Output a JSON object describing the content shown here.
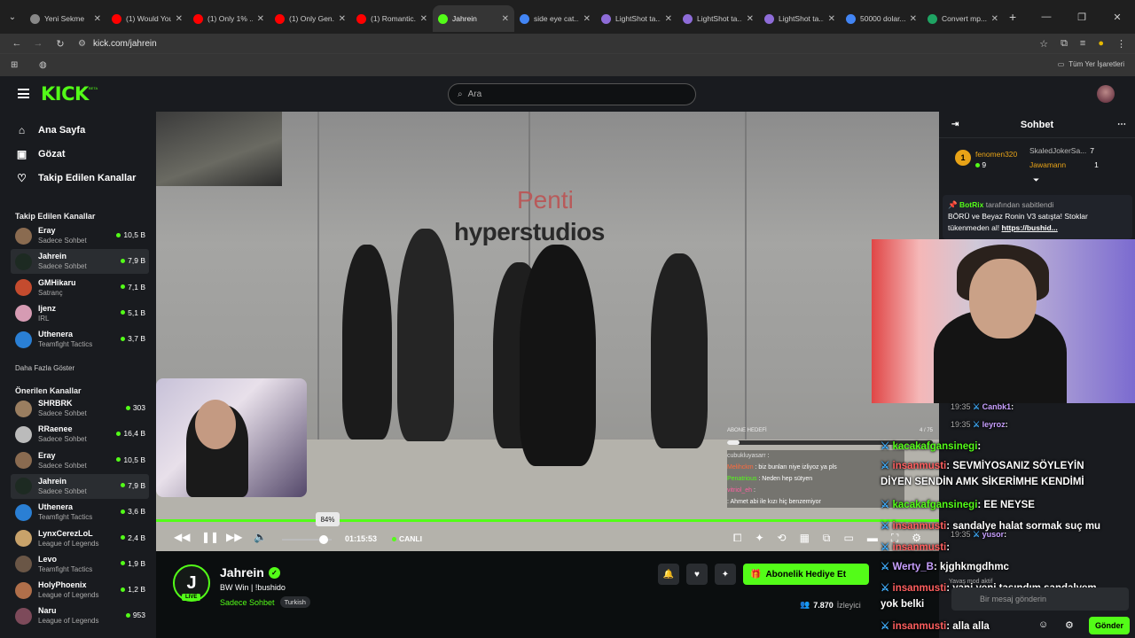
{
  "browser": {
    "tabs": [
      {
        "title": "Yeni Sekme",
        "color": "#888888"
      },
      {
        "title": "(1) Would You...",
        "color": "#ff0000"
      },
      {
        "title": "(1) Only 1% ...",
        "color": "#ff0000"
      },
      {
        "title": "(1) Only Gen...",
        "color": "#ff0000"
      },
      {
        "title": "(1) Romantic...",
        "color": "#ff0000"
      },
      {
        "title": "Jahrein",
        "color": "#53fc18"
      },
      {
        "title": "side eye cat...",
        "color": "#4285f4"
      },
      {
        "title": "LightShot ta...",
        "color": "#8e6cd8"
      },
      {
        "title": "LightShot ta...",
        "color": "#8e6cd8"
      },
      {
        "title": "LightShot ta...",
        "color": "#8e6cd8"
      },
      {
        "title": "50000 dolar...",
        "color": "#4285f4"
      },
      {
        "title": "Convert mp...",
        "color": "#1fa463"
      }
    ],
    "url": "kick.com/jahrein",
    "bookmarks_right": "Tüm Yer İşaretleri"
  },
  "header": {
    "logo": "KICK",
    "beta": "BETA",
    "search_placeholder": "Ara"
  },
  "sidebar": {
    "nav": [
      {
        "label": "Ana Sayfa",
        "icon": "home-icon",
        "glyph": "⌂"
      },
      {
        "label": "Gözat",
        "icon": "browse-icon",
        "glyph": "▣"
      },
      {
        "label": "Takip Edilen Kanallar",
        "icon": "heart-icon",
        "glyph": "♡"
      }
    ],
    "followed_title": "Takip Edilen Kanallar",
    "followed": [
      {
        "name": "Eray",
        "cat": "Sadece Sohbet",
        "viewers": "10,5 B",
        "color": "#8a6b50"
      },
      {
        "name": "Jahrein",
        "cat": "Sadece Sohbet",
        "viewers": "7,9 B",
        "color": "#1d2a22",
        "selected": true
      },
      {
        "name": "GMHikaru",
        "cat": "Satranç",
        "viewers": "7,1 B",
        "color": "#c44b2e"
      },
      {
        "name": "Ijenz",
        "cat": "IRL",
        "viewers": "5,1 B",
        "color": "#d69bb3"
      },
      {
        "name": "Uthenera",
        "cat": "Teamfight Tactics",
        "viewers": "3,7 B",
        "color": "#2a7fd4"
      }
    ],
    "more": "Daha Fazla Göster",
    "recommended_title": "Önerilen Kanallar",
    "recommended": [
      {
        "name": "SHRBRK",
        "cat": "Sadece Sohbet",
        "viewers": "303",
        "color": "#9a7e60"
      },
      {
        "name": "RRaenee",
        "cat": "Sadece Sohbet",
        "viewers": "16,4 B",
        "color": "#bbbbbb"
      },
      {
        "name": "Eray",
        "cat": "Sadece Sohbet",
        "viewers": "10,5 B",
        "color": "#8a6b50"
      },
      {
        "name": "Jahrein",
        "cat": "Sadece Sohbet",
        "viewers": "7,9 B",
        "color": "#1d2a22",
        "selected": true
      },
      {
        "name": "Uthenera",
        "cat": "Teamfight Tactics",
        "viewers": "3,6 B",
        "color": "#2a7fd4"
      },
      {
        "name": "LynxCerezLoL",
        "cat": "League of Legends",
        "viewers": "2,4 B",
        "color": "#c8a26a"
      },
      {
        "name": "Levo",
        "cat": "Teamfight Tactics",
        "viewers": "1,9 B",
        "color": "#6a5646"
      },
      {
        "name": "HolyPhoenix",
        "cat": "League of Legends",
        "viewers": "1,2 B",
        "color": "#b06f4a"
      },
      {
        "name": "Naru",
        "cat": "League of Legends",
        "viewers": "953",
        "color": "#7d4a5a"
      }
    ]
  },
  "video": {
    "brand_top": "Penti",
    "brand_bottom": "hyperstudios",
    "volume_pct": "84%",
    "volume_level": 0.84,
    "time": "01:15:53",
    "live_label": "CANLI",
    "progress": 1.0,
    "overlay_goal": "ABONE HEDEFİ",
    "overlay_goal_count": "4 / 75",
    "overlay_chat": [
      {
        "user": "cubukluyasarr",
        "text": ":",
        "color": "#dddddd"
      },
      {
        "user": "Melihckm",
        "text": ": biz bunları niye izliyoz ya pls",
        "color": "#ff6a3d"
      },
      {
        "user": "",
        "text": "",
        "color": "#d03030"
      },
      {
        "user": "Penatrious",
        "text": ": Neden hep sütyen",
        "color": "#53fc18"
      },
      {
        "user": "vitriol_eh",
        "text": ":",
        "color": "#ff5fa2"
      },
      {
        "user": "",
        "text": ": Ahmet abi ile kızı hiç benzemiyor",
        "color": "#d03030"
      }
    ]
  },
  "channel": {
    "name": "Jahrein",
    "live_badge": "LIVE",
    "title": "BW Win | !bushido",
    "category": "Sadece Sohbet",
    "tag": "Turkish",
    "gift_label": "Abonelik Hediye Et",
    "viewers": "7.870",
    "viewers_label": "İzleyici"
  },
  "chat": {
    "title": "Sohbet",
    "leaders": [
      {
        "name": "fenomen320",
        "count": "9",
        "rank": "1"
      },
      {
        "name": "SkaledJokerSa...",
        "count": "7"
      },
      {
        "name": "Jawamann",
        "count": "1"
      }
    ],
    "pinned_by": "BotRix",
    "pinned_suffix": "tarafından sabitlendi",
    "pinned_text": "BÖRÜ ve Beyaz Ronin V3 satışta! Stoklar tükenmeden al!",
    "pinned_link": "https://bushid...",
    "lines": [
      {
        "time": "19:35",
        "user": "Canbk1",
        "text": ":",
        "color": "#c8a0ff"
      },
      {
        "time": "19:35",
        "user": "leyroz",
        "text": ":",
        "color": "#c8a0ff"
      },
      {
        "time": "",
        "user": "kacakafgansinegi",
        "text": ":",
        "color": "#53fc18"
      },
      {
        "time": "",
        "user": "insanmusti",
        "text": ": SEVMİYOSANIZ SÖYLEYİN",
        "color": "#ff5f5f"
      },
      {
        "time": "",
        "user": "",
        "text": "DİYEN SENDİN AMK SİKERİMHE KENDİMİ",
        "color": "#ffffff"
      },
      {
        "time": "",
        "user": "kacakafgansinegi",
        "text": ": EE NEYSE",
        "color": "#53fc18"
      },
      {
        "time": "",
        "user": "insanmusti",
        "text": ": sandalye halat sormak suç mu",
        "color": "#ff5f5f"
      },
      {
        "time": "19:35",
        "user": "yusor",
        "text": ":",
        "color": "#c8a0ff"
      },
      {
        "time": "",
        "user": "insanmusti",
        "text": ":",
        "color": "#ff5f5f"
      },
      {
        "time": "",
        "user": "Werty_B",
        "text": ": kjghkmgdhmc",
        "color": "#c8a0ff"
      },
      {
        "time": "",
        "user": "insanmusti",
        "text": ": yani yeni taşındım sandalyem",
        "color": "#ff5f5f"
      },
      {
        "time": "",
        "user": "",
        "text": "yok belki",
        "color": "#ffffff"
      },
      {
        "time": "",
        "user": "insanmusti",
        "text": ": alla alla",
        "color": "#ff5f5f"
      }
    ],
    "slow_mode": "Yavaş mod aktif",
    "placeholder": "Bir mesaj gönderin",
    "send_label": "Gönder"
  }
}
